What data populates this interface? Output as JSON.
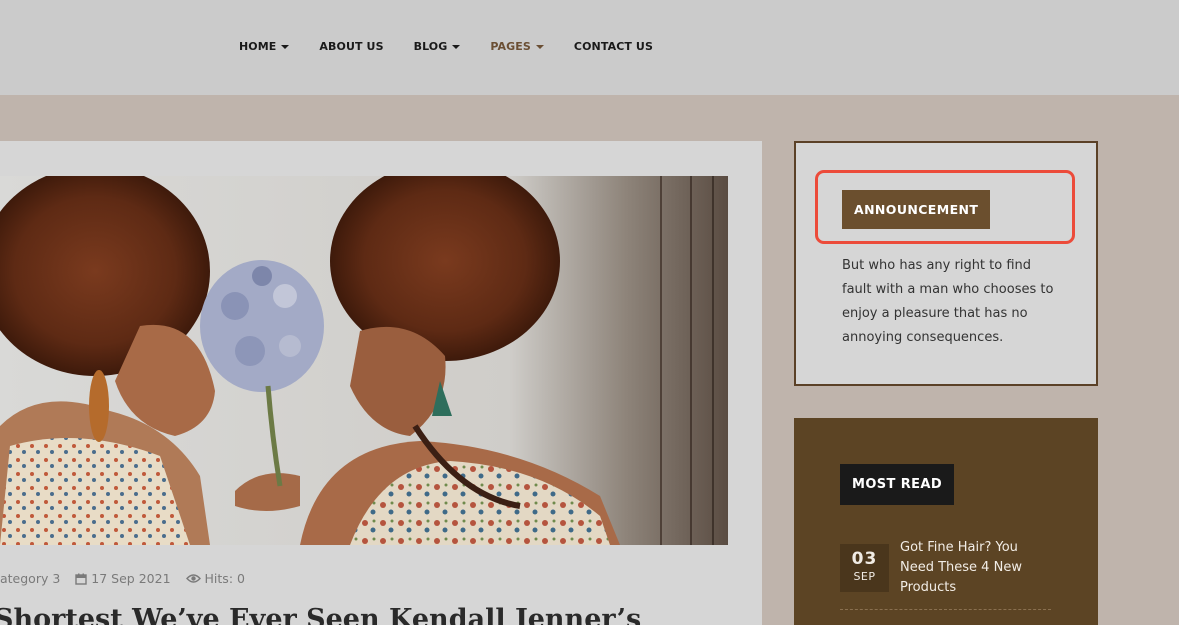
{
  "nav": {
    "items": [
      {
        "label": "HOME",
        "has_caret": true
      },
      {
        "label": "ABOUT US",
        "has_caret": false
      },
      {
        "label": "BLOG",
        "has_caret": true
      },
      {
        "label": "PAGES",
        "has_caret": true,
        "active": true
      },
      {
        "label": "CONTACT US",
        "has_caret": false
      }
    ]
  },
  "article": {
    "category": "ategory 3",
    "date": "17 Sep 2021",
    "hits": "Hits: 0",
    "title": "Shortest We’ve Ever Seen Kendall Jenner’s"
  },
  "sidebar": {
    "announcement": {
      "label": "ANNOUNCEMENT",
      "text": "But who has any right to find fault with a man who chooses to enjoy a pleasure that has no annoying consequences."
    },
    "most_read": {
      "label": "MOST READ",
      "posts": [
        {
          "day": "03",
          "month": "SEP",
          "title": "Got Fine Hair? You Need These 4 New Products"
        }
      ]
    }
  },
  "colors": {
    "accent": "#6b4f2e",
    "highlight": "#ec4b3a",
    "active_nav": "#6b4f34",
    "page_bg": "#bfb4ac",
    "header_bg": "#cbcbcb",
    "dark_panel": "#5c4424"
  },
  "icons": [
    "caret-down-icon",
    "calendar-icon",
    "eye-icon"
  ]
}
